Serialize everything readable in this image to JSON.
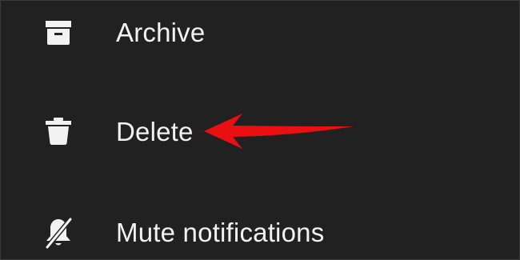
{
  "menu": {
    "items": [
      {
        "label": "Archive",
        "icon": "archive-icon"
      },
      {
        "label": "Delete",
        "icon": "trash-icon"
      },
      {
        "label": "Mute notifications",
        "icon": "bell-off-icon"
      }
    ]
  },
  "colors": {
    "background": "#212121",
    "text": "#f2f2f2",
    "annotation_arrow": "#e90f13"
  }
}
